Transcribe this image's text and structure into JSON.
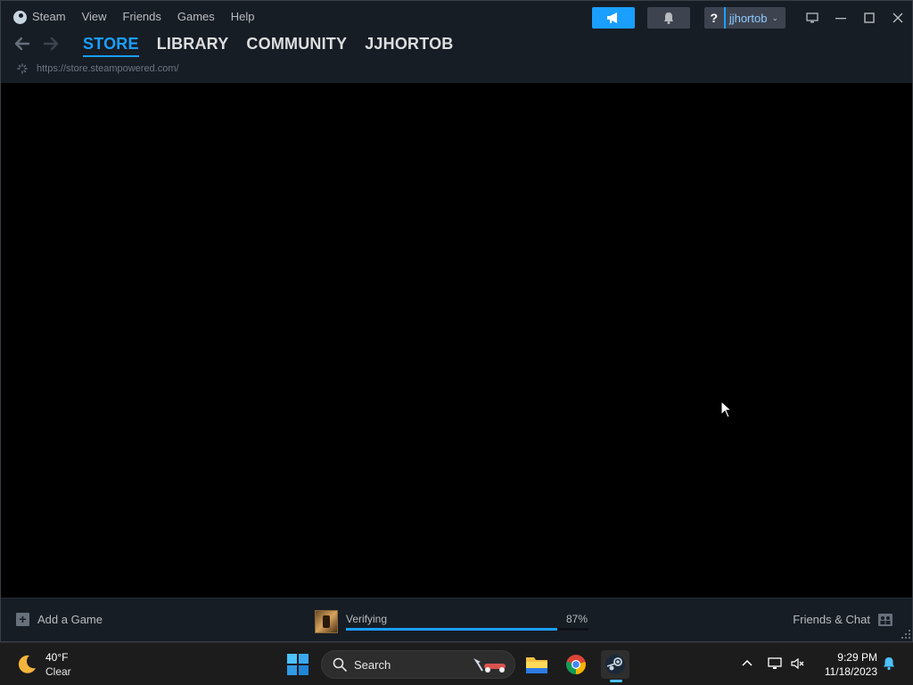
{
  "menu": {
    "steam": "Steam",
    "view": "View",
    "friends": "Friends",
    "games": "Games",
    "help": "Help"
  },
  "header": {
    "help_glyph": "?",
    "account_name": "jjhortob",
    "account_chevron": "⌄"
  },
  "nav": {
    "tabs": [
      {
        "label": "STORE",
        "active": true
      },
      {
        "label": "LIBRARY",
        "active": false
      },
      {
        "label": "COMMUNITY",
        "active": false
      },
      {
        "label": "JJHORTOB",
        "active": false
      }
    ],
    "url": "https://store.steampowered.com/"
  },
  "bottom": {
    "add_game": "Add a Game",
    "download_status": "Verifying",
    "download_percent": "87%",
    "download_progress": 0.87,
    "friends_chat": "Friends & Chat"
  },
  "taskbar": {
    "weather_temp": "40°F",
    "weather_cond": "Clear",
    "search_label": "Search",
    "time": "9:29 PM",
    "date": "11/18/2023"
  },
  "colors": {
    "accent": "#1a9fff",
    "titlebar": "#171d25",
    "taskbar": "#1c1c1c"
  }
}
